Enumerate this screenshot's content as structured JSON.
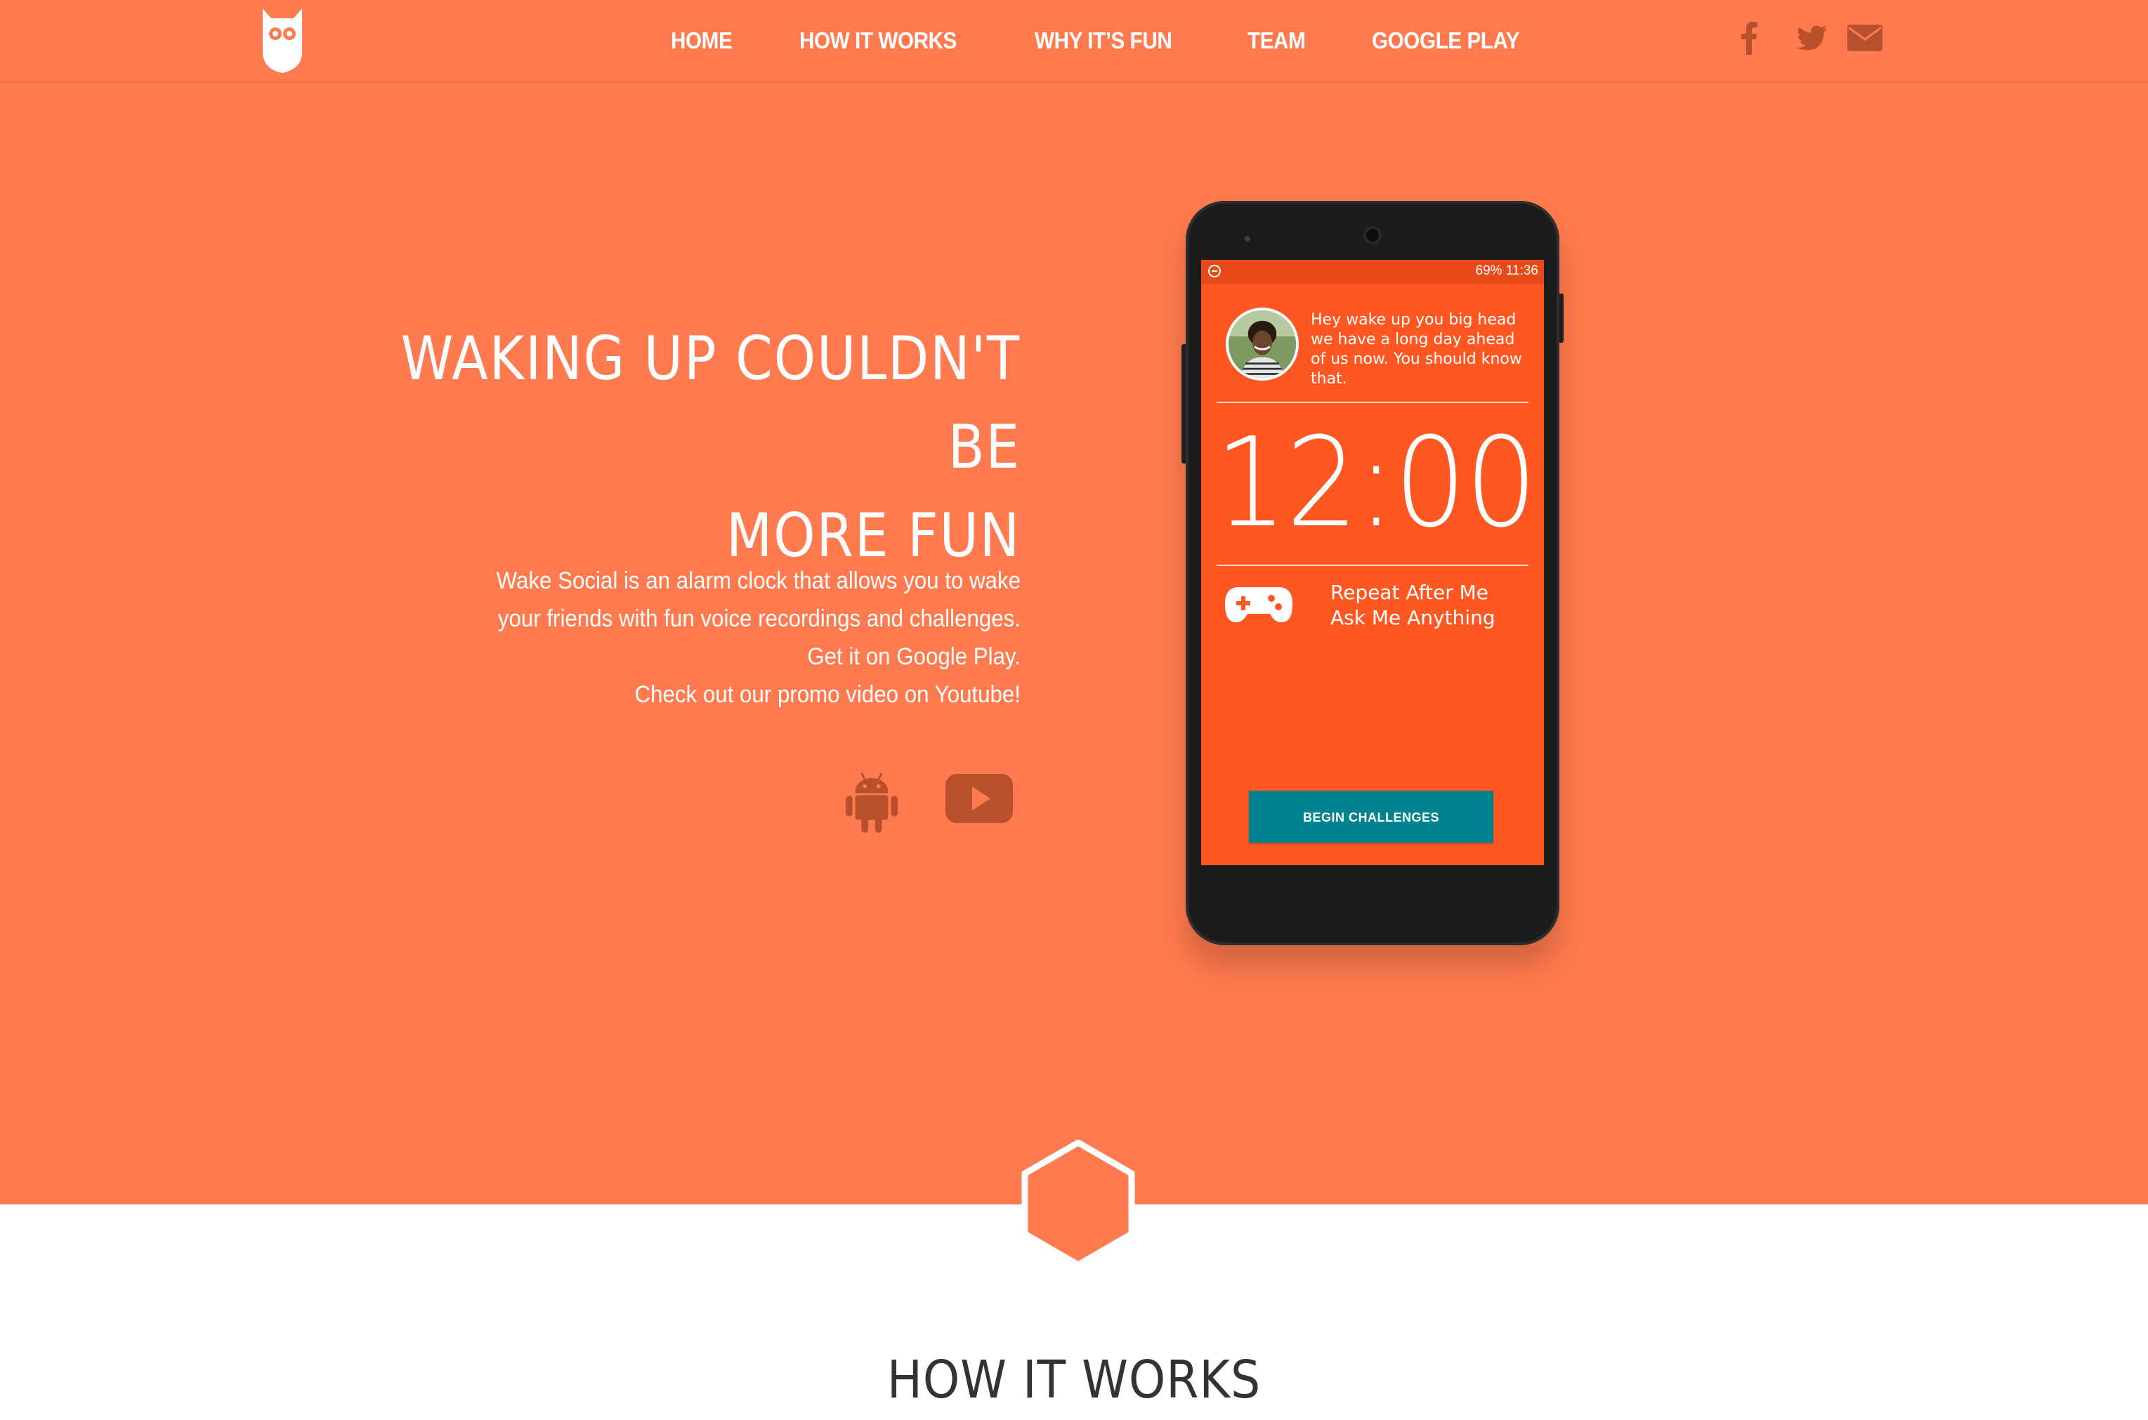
{
  "nav": {
    "links": [
      "HOME",
      "HOW IT WORKS",
      "WHY IT’S FUN",
      "TEAM",
      "GOOGLE PLAY"
    ],
    "logo_icon": "owl-icon",
    "social_icons": [
      "facebook-icon",
      "twitter-icon",
      "mail-icon"
    ]
  },
  "hero": {
    "title_line1": "WAKING UP COULDN'T BE",
    "title_line2": "MORE FUN",
    "desc_line1": "Wake Social is an alarm clock that allows you to wake",
    "desc_line2": "your friends with fun voice recordings and challenges.",
    "desc_line3": "Get it on Google Play.",
    "desc_line4": "Check out our promo video on Youtube!",
    "icons": [
      "android-icon",
      "youtube-icon"
    ]
  },
  "phone": {
    "status": "69%  11:36",
    "message": "Hey wake up you big head we have a long day ahead of us now. You should know that.",
    "time": "12:00",
    "challenge_1": "Repeat After Me",
    "challenge_2": "Ask Me Anything",
    "button": "BEGIN CHALLENGES"
  },
  "section": {
    "title": "HOW IT WORKS"
  },
  "colors": {
    "hero_bg": "#ff7a4e",
    "screen_bg": "#ff5722",
    "button_bg": "#00838f",
    "icon_dark": "#b9502d"
  }
}
